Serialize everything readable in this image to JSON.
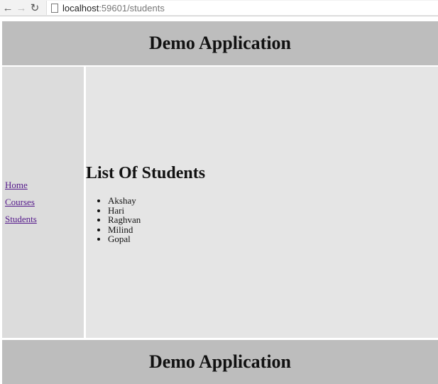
{
  "browser": {
    "url_host": "localhost",
    "url_rest": ":59601/students"
  },
  "header": {
    "title": "Demo Application"
  },
  "sidebar": {
    "items": [
      {
        "label": "Home"
      },
      {
        "label": "Courses"
      },
      {
        "label": "Students"
      }
    ]
  },
  "main": {
    "heading": "List Of Students",
    "students": [
      "Akshay",
      "Hari",
      "Raghvan",
      "Milind",
      "Gopal"
    ]
  },
  "footer": {
    "title": "Demo Application"
  }
}
